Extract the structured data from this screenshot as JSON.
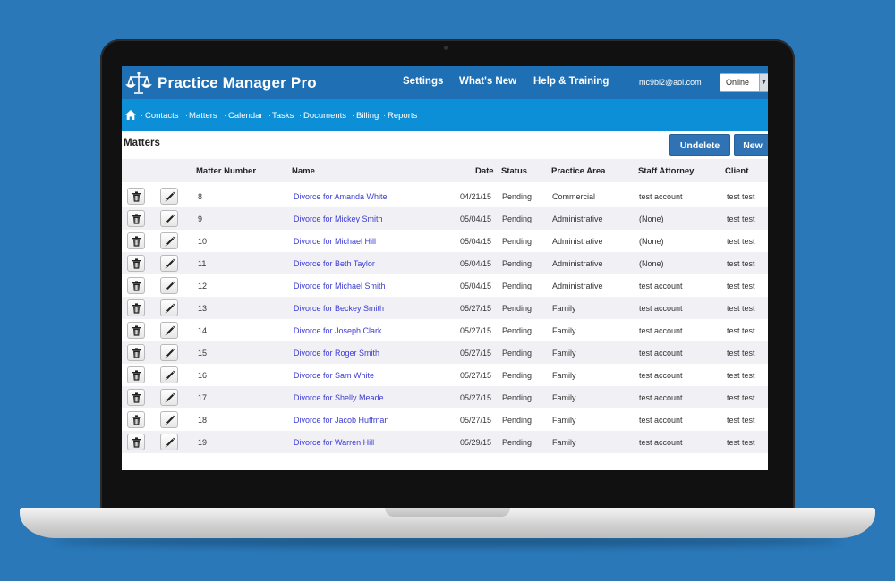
{
  "app": {
    "name": "Practice Manager Pro",
    "logo_icon": "scales-of-justice-icon"
  },
  "topnav": {
    "items": [
      "Settings",
      "What's New",
      "Help & Training"
    ]
  },
  "user": {
    "email": "mc9bl2@aol.com",
    "status": "Online"
  },
  "subnav": {
    "home_icon": "home-icon",
    "items": [
      "Contacts",
      "Matters",
      "Calendar",
      "Tasks",
      "Documents",
      "Billing",
      "Reports"
    ]
  },
  "page": {
    "title": "Matters",
    "undelete_label": "Undelete",
    "new_label": "New"
  },
  "table": {
    "columns": [
      "Matter Number",
      "Name",
      "Date",
      "Status",
      "Practice Area",
      "Staff Attorney",
      "Client"
    ],
    "row_icons": [
      "trash-icon",
      "pencil-icon"
    ],
    "rows": [
      {
        "number": "8",
        "name": "Divorce for Amanda White",
        "date": "04/21/15",
        "status": "Pending",
        "area": "Commercial",
        "attorney": "test account",
        "client": "test test"
      },
      {
        "number": "9",
        "name": "Divorce for Mickey Smith",
        "date": "05/04/15",
        "status": "Pending",
        "area": "Administrative",
        "attorney": "(None)",
        "client": "test test"
      },
      {
        "number": "10",
        "name": "Divorce for Michael Hill",
        "date": "05/04/15",
        "status": "Pending",
        "area": "Administrative",
        "attorney": "(None)",
        "client": "test test"
      },
      {
        "number": "11",
        "name": "Divorce for Beth Taylor",
        "date": "05/04/15",
        "status": "Pending",
        "area": "Administrative",
        "attorney": "(None)",
        "client": "test test"
      },
      {
        "number": "12",
        "name": "Divorce for Michael Smith",
        "date": "05/04/15",
        "status": "Pending",
        "area": "Administrative",
        "attorney": "test account",
        "client": "test test"
      },
      {
        "number": "13",
        "name": "Divorce for Beckey Smith",
        "date": "05/27/15",
        "status": "Pending",
        "area": "Family",
        "attorney": "test account",
        "client": "test test"
      },
      {
        "number": "14",
        "name": "Divorce for Joseph Clark",
        "date": "05/27/15",
        "status": "Pending",
        "area": "Family",
        "attorney": "test account",
        "client": "test test"
      },
      {
        "number": "15",
        "name": "Divorce for Roger Smith",
        "date": "05/27/15",
        "status": "Pending",
        "area": "Family",
        "attorney": "test account",
        "client": "test test"
      },
      {
        "number": "16",
        "name": "Divorce for Sam White",
        "date": "05/27/15",
        "status": "Pending",
        "area": "Family",
        "attorney": "test account",
        "client": "test test"
      },
      {
        "number": "17",
        "name": "Divorce for Shelly Meade",
        "date": "05/27/15",
        "status": "Pending",
        "area": "Family",
        "attorney": "test account",
        "client": "test test"
      },
      {
        "number": "18",
        "name": "Divorce for Jacob Huffman",
        "date": "05/27/15",
        "status": "Pending",
        "area": "Family",
        "attorney": "test account",
        "client": "test test"
      },
      {
        "number": "19",
        "name": "Divorce for Warren Hill",
        "date": "05/29/15",
        "status": "Pending",
        "area": "Family",
        "attorney": "test account",
        "client": "test test"
      }
    ]
  },
  "colors": {
    "background": "#2a78b8",
    "topbar": "#1f6fb4",
    "subbar": "#0d8fd8",
    "button": "#2f73b5",
    "link": "#3b3bd4",
    "row_alt": "#f1f0f5"
  }
}
